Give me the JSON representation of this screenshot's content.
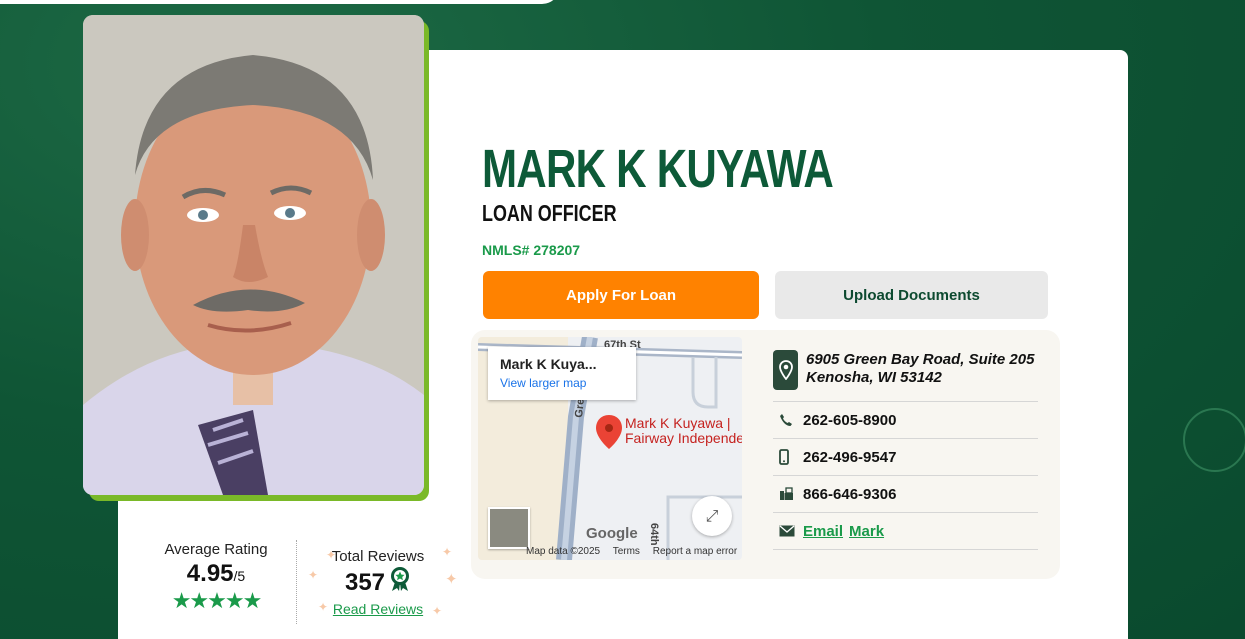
{
  "officer": {
    "name": "MARK K KUYAWA",
    "title": "LOAN OFFICER",
    "nmls": "NMLS# 278207"
  },
  "actions": {
    "apply_label": "Apply For Loan",
    "upload_label": "Upload Documents"
  },
  "map": {
    "card_title": "Mark K Kuya...",
    "card_link": "View larger map",
    "marker_label_line1": "Mark K Kuyawa |",
    "marker_label_line2": "Fairway Independe",
    "street_1": "67th St",
    "street_2": "Green",
    "street_3": "64th",
    "google": "Google",
    "footer_data": "Map data ©2025",
    "footer_terms": "Terms",
    "footer_report": "Report a map error"
  },
  "contact": {
    "address_line1": "6905 Green Bay Road, Suite 205",
    "address_line2": "Kenosha, WI  53142",
    "phone": "262-605-8900",
    "mobile": "262-496-9547",
    "fax": "866-646-9306",
    "email_label": "Email",
    "email_name": "Mark"
  },
  "rating": {
    "label": "Average Rating",
    "value": "4.95",
    "out_of": "/5",
    "stars": "★★★★★",
    "stars_value": 4.95
  },
  "reviews": {
    "label": "Total Reviews",
    "count": "357",
    "link": "Read Reviews"
  },
  "colors": {
    "brand_green": "#0d5a38",
    "accent_orange": "#ff8200",
    "lime": "#7ab928",
    "link_green": "#1a9a4a"
  }
}
